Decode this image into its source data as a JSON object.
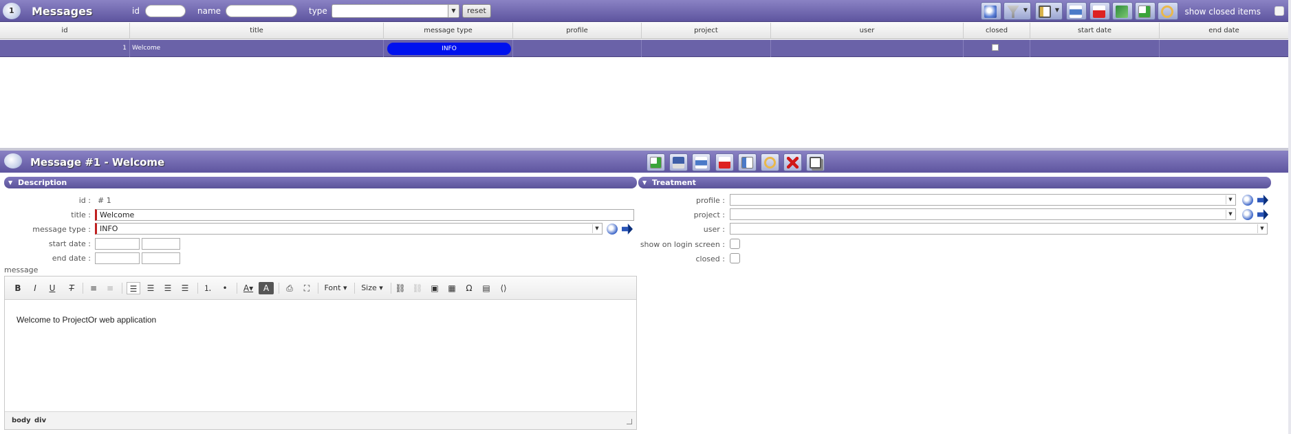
{
  "header": {
    "logo_badge": "1",
    "title": "Messages",
    "filters": {
      "id_label": "id",
      "name_label": "name",
      "type_label": "type",
      "reset_label": "reset"
    },
    "show_closed_label": "show closed items"
  },
  "grid": {
    "columns": [
      "id",
      "title",
      "message type",
      "profile",
      "project",
      "user",
      "closed",
      "start date",
      "end date"
    ],
    "rows": [
      {
        "id": "1",
        "title": "Welcome",
        "message_type": "INFO",
        "profile": "",
        "project": "",
        "user": "",
        "closed": false,
        "start_date": "",
        "end_date": ""
      }
    ]
  },
  "detail": {
    "title": "Message  #1 - Welcome",
    "description_section": "Description",
    "treatment_section": "Treatment",
    "fields": {
      "id_label": "id :",
      "id_value": "# 1",
      "title_label": "title :",
      "title_value": "Welcome",
      "message_type_label": "message type :",
      "message_type_value": "INFO",
      "start_date_label": "start date :",
      "end_date_label": "end date :",
      "message_label": "message"
    },
    "treatment": {
      "profile_label": "profile :",
      "project_label": "project :",
      "user_label": "user :",
      "show_login_label": "show on login screen :",
      "closed_label": "closed :"
    }
  },
  "editor": {
    "toolbar": {
      "font_label": "Font",
      "size_label": "Size"
    },
    "content": "Welcome to ProjectOr web application",
    "path": [
      "body",
      "div"
    ]
  },
  "colors": {
    "header": "#6a62a8",
    "info_badge": "#0011ee",
    "required": "#c02020"
  }
}
